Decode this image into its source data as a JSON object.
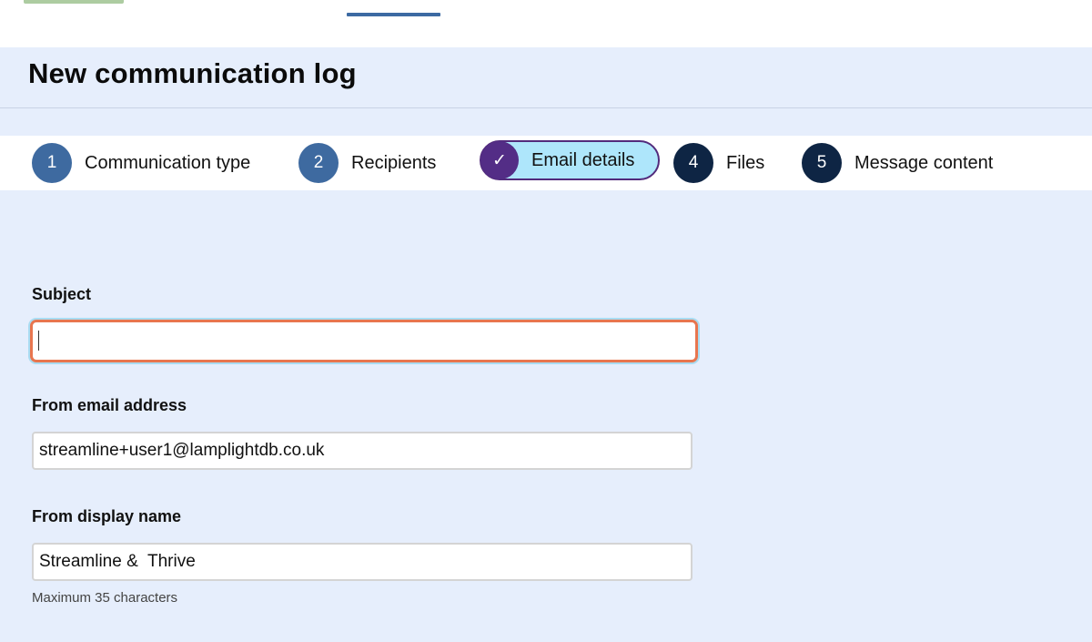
{
  "page": {
    "title": "New communication log"
  },
  "steps": [
    {
      "number": "1",
      "label": "Communication type",
      "state": "completed"
    },
    {
      "number": "2",
      "label": "Recipients",
      "state": "completed"
    },
    {
      "number": "✓",
      "label": "Email details",
      "state": "current"
    },
    {
      "number": "4",
      "label": "Files",
      "state": "upcoming"
    },
    {
      "number": "5",
      "label": "Message content",
      "state": "upcoming"
    }
  ],
  "form": {
    "subject": {
      "label": "Subject",
      "value": ""
    },
    "from_email": {
      "label": "From email address",
      "value": "streamline+user1@lamplightdb.co.uk"
    },
    "display_name": {
      "label": "From display name",
      "value": "Streamline &  Thrive",
      "hint": "Maximum 35 characters"
    }
  },
  "colors": {
    "background": "#e6eefc",
    "step_done": "#3e6aa0",
    "step_todo": "#0e2544",
    "step_active_fill": "#aee6fb",
    "step_active_border": "#522b7c",
    "focus_border": "#e8764f"
  }
}
